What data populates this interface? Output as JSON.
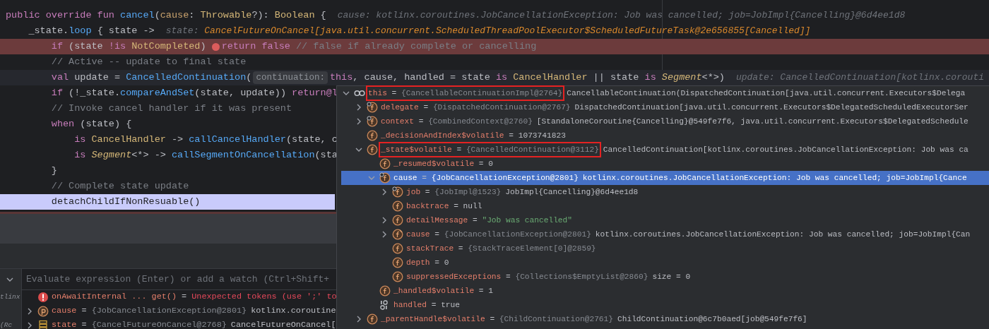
{
  "code": {
    "lines": [
      {
        "kind": "normal",
        "tokens": [
          {
            "t": "public override fun ",
            "kind": "keyword"
          },
          {
            "t": "cancel",
            "kind": "function"
          },
          {
            "t": "(",
            "kind": "plain"
          },
          {
            "t": "cause",
            "kind": "param"
          },
          {
            "t": ": ",
            "kind": "plain"
          },
          {
            "t": "Throwable",
            "kind": "type"
          },
          {
            "t": "?): ",
            "kind": "plain"
          },
          {
            "t": "Boolean",
            "kind": "type"
          },
          {
            "t": " {",
            "kind": "plain"
          },
          {
            "t": "cause: kotlinx.coroutines.JobCancellationException: Job was cancelled; job=JobImpl{Cancelling}@6d4ee1d8",
            "kind": "hint-label"
          }
        ]
      },
      {
        "kind": "normal",
        "tokens": [
          {
            "t": "    _state.",
            "kind": "plain"
          },
          {
            "t": "loop",
            "kind": "function"
          },
          {
            "t": " { state ->",
            "kind": "plain"
          },
          {
            "t": "state: ",
            "kind": "hint-label"
          },
          {
            "t": "CancelFutureOnCancel[java.util.concurrent.ScheduledThreadPoolExecutor$ScheduledFutureTask@2e656855[Cancelled]]",
            "kind": "hint-value"
          }
        ]
      },
      {
        "kind": "breakpoint",
        "tokens": [
          {
            "t": "        if",
            "kind": "keyword"
          },
          {
            "t": " (state ",
            "kind": "plain"
          },
          {
            "t": "!is",
            "kind": "keyword"
          },
          {
            "t": " NotCompleted",
            "kind": "type"
          },
          {
            "t": ") ",
            "kind": "plain"
          },
          {
            "kind": "breakpoint"
          },
          {
            "t": "return false",
            "kind": "keyword"
          },
          {
            "t": " // false if already complete or cancelling",
            "kind": "comment"
          }
        ]
      },
      {
        "kind": "normal",
        "tokens": [
          {
            "t": "        // Active -- update to final state",
            "kind": "comment"
          }
        ]
      },
      {
        "kind": "current",
        "tokens": [
          {
            "t": "        val",
            "kind": "keyword"
          },
          {
            "t": " update = ",
            "kind": "plain"
          },
          {
            "t": "CancelledContinuation",
            "kind": "function"
          },
          {
            "t": "(",
            "kind": "plain"
          },
          {
            "t": "continuation:",
            "kind": "param-hint"
          },
          {
            "t": "this",
            "kind": "keyword"
          },
          {
            "t": ", cause, handled = state ",
            "kind": "plain"
          },
          {
            "t": "is",
            "kind": "keyword"
          },
          {
            "t": " CancelHandler ",
            "kind": "type"
          },
          {
            "t": "|| state ",
            "kind": "plain"
          },
          {
            "t": "is",
            "kind": "keyword"
          },
          {
            "t": " Segment",
            "kind": "type-italic"
          },
          {
            "t": "<*>)",
            "kind": "plain"
          },
          {
            "t": "update: CancelledContinuation[kotlinx.corouti",
            "kind": "hint-label"
          }
        ]
      },
      {
        "kind": "normal",
        "tokens": [
          {
            "t": "        if",
            "kind": "keyword"
          },
          {
            "t": " (!_state.",
            "kind": "plain"
          },
          {
            "t": "compareAndSet",
            "kind": "function"
          },
          {
            "t": "(state, update)) ",
            "kind": "plain"
          },
          {
            "t": "return@l",
            "kind": "keyword"
          }
        ]
      },
      {
        "kind": "normal",
        "tokens": [
          {
            "t": "        // Invoke cancel handler if it was present",
            "kind": "comment"
          }
        ]
      },
      {
        "kind": "normal",
        "tokens": [
          {
            "t": "        when",
            "kind": "keyword"
          },
          {
            "t": " (state) {",
            "kind": "plain"
          }
        ]
      },
      {
        "kind": "normal",
        "tokens": [
          {
            "t": "            is",
            "kind": "keyword"
          },
          {
            "t": " CancelHandler",
            "kind": "type"
          },
          {
            "t": " -> ",
            "kind": "plain"
          },
          {
            "t": "callCancelHandler",
            "kind": "function"
          },
          {
            "t": "(state, c",
            "kind": "plain"
          }
        ]
      },
      {
        "kind": "normal",
        "tokens": [
          {
            "t": "            is",
            "kind": "keyword"
          },
          {
            "t": " Segment",
            "kind": "type-italic"
          },
          {
            "t": "<*> -> ",
            "kind": "plain"
          },
          {
            "t": "callSegmentOnCancellation",
            "kind": "function"
          },
          {
            "t": "(sta",
            "kind": "plain"
          }
        ]
      },
      {
        "kind": "normal",
        "tokens": [
          {
            "t": "        }",
            "kind": "plain"
          }
        ]
      },
      {
        "kind": "normal",
        "tokens": [
          {
            "t": "        // Complete state update",
            "kind": "comment"
          }
        ]
      },
      {
        "kind": "execution",
        "tokens": [
          {
            "t": "        detachChildIfNonResuable()",
            "kind": "plain"
          }
        ]
      }
    ]
  },
  "debugger": {
    "evaluate": {
      "placeholder": "Evaluate expression (Enter) or add a watch (Ctrl+Shift+"
    },
    "side_fragments": [
      "tlinx",
      "(Rc"
    ],
    "variables": [
      {
        "kind": "error",
        "name": "onAwaitInternal ... get()",
        "eq": "=",
        "error": "Unexpected tokens (use ';' to",
        "selected": false
      },
      {
        "kind": "param",
        "name": "cause",
        "eq": "=",
        "expanded": false,
        "ref": "{JobCancellationException@2801}",
        "desc": "kotlinx.coroutine",
        "selected": false
      },
      {
        "kind": "list",
        "name": "state",
        "eq": "=",
        "expanded": false,
        "ref": "{CancelFutureOnCancel@2768}",
        "desc": "CancelFutureOnCancel[",
        "selected": false
      }
    ]
  },
  "popup": {
    "tree": [
      {
        "kind": "watch",
        "name": "this",
        "eq": "=",
        "expanded": true,
        "boxed": true,
        "selected": false,
        "ref": "{CancellableContinuationImpl@2764}",
        "desc": "CancellableContinuation(DispatchedContinuation[java.util.concurrent.Executors$Delega",
        "children": [
          {
            "kind": "field-linked",
            "name": "delegate",
            "eq": "=",
            "expanded": false,
            "selected": false,
            "ref": "{DispatchedContinuation@2767}",
            "desc": "DispatchedContinuation[java.util.concurrent.Executors$DelegatedScheduledExecutorSer"
          },
          {
            "kind": "field-linked",
            "name": "context",
            "eq": "=",
            "expanded": false,
            "selected": false,
            "ref": "{CombinedContext@2760}",
            "desc": "[StandaloneCoroutine{Cancelling}@549fe7f6, java.util.concurrent.Executors$DelegatedSchedule"
          },
          {
            "kind": "field",
            "name": "_decisionAndIndex$volatile",
            "eq": "=",
            "selected": false,
            "value": "1073741823"
          },
          {
            "kind": "field",
            "name": "_state$volatile",
            "eq": "=",
            "expanded": true,
            "boxed": true,
            "selected": false,
            "ref": "{CancelledContinuation@3112}",
            "desc": "CancelledContinuation[kotlinx.coroutines.JobCancellationException: Job was ca",
            "children": [
              {
                "kind": "field",
                "name": "_resumed$volatile",
                "eq": "=",
                "selected": false,
                "value": "0"
              },
              {
                "kind": "field-linked",
                "name": "cause",
                "eq": "=",
                "expanded": true,
                "selected": true,
                "ref": "{JobCancellationException@2801}",
                "desc": "kotlinx.coroutines.JobCancellationException: Job was cancelled; job=JobImpl{Cance",
                "children": [
                  {
                    "kind": "field-linked",
                    "name": "job",
                    "eq": "=",
                    "expanded": false,
                    "selected": false,
                    "ref": "{JobImpl@1523}",
                    "desc": "JobImpl{Cancelling}@6d4ee1d8"
                  },
                  {
                    "kind": "field",
                    "name": "backtrace",
                    "eq": "=",
                    "selected": false,
                    "value": "null"
                  },
                  {
                    "kind": "field",
                    "name": "detailMessage",
                    "eq": "=",
                    "expanded": false,
                    "selected": false,
                    "string": "\"Job was cancelled\""
                  },
                  {
                    "kind": "field-final",
                    "name": "cause",
                    "eq": "=",
                    "expanded": false,
                    "selected": false,
                    "ref": "{JobCancellationException@2801}",
                    "desc": "kotlinx.coroutines.JobCancellationException: Job was cancelled; job=JobImpl{Can"
                  },
                  {
                    "kind": "field",
                    "name": "stackTrace",
                    "eq": "=",
                    "selected": false,
                    "ref": "{StackTraceElement[0]@2859}"
                  },
                  {
                    "kind": "field",
                    "name": "depth",
                    "eq": "=",
                    "selected": false,
                    "value": "0"
                  },
                  {
                    "kind": "field",
                    "name": "suppressedExceptions",
                    "eq": "=",
                    "selected": false,
                    "ref": "{Collections$EmptyList@2860}",
                    "desc": "size = 0"
                  }
                ]
              },
              {
                "kind": "field",
                "name": "_handled$volatile",
                "eq": "=",
                "selected": false,
                "value": "1"
              },
              {
                "kind": "binary",
                "name": "handled",
                "eq": "=",
                "selected": false,
                "value": "true"
              }
            ]
          },
          {
            "kind": "field",
            "name": "_parentHandle$volatile",
            "eq": "=",
            "expanded": false,
            "selected": false,
            "ref": "{ChildContinuation@2761}",
            "desc": "ChildContinuation@6c7b0aed[job@549fe7f6]"
          }
        ]
      }
    ]
  }
}
